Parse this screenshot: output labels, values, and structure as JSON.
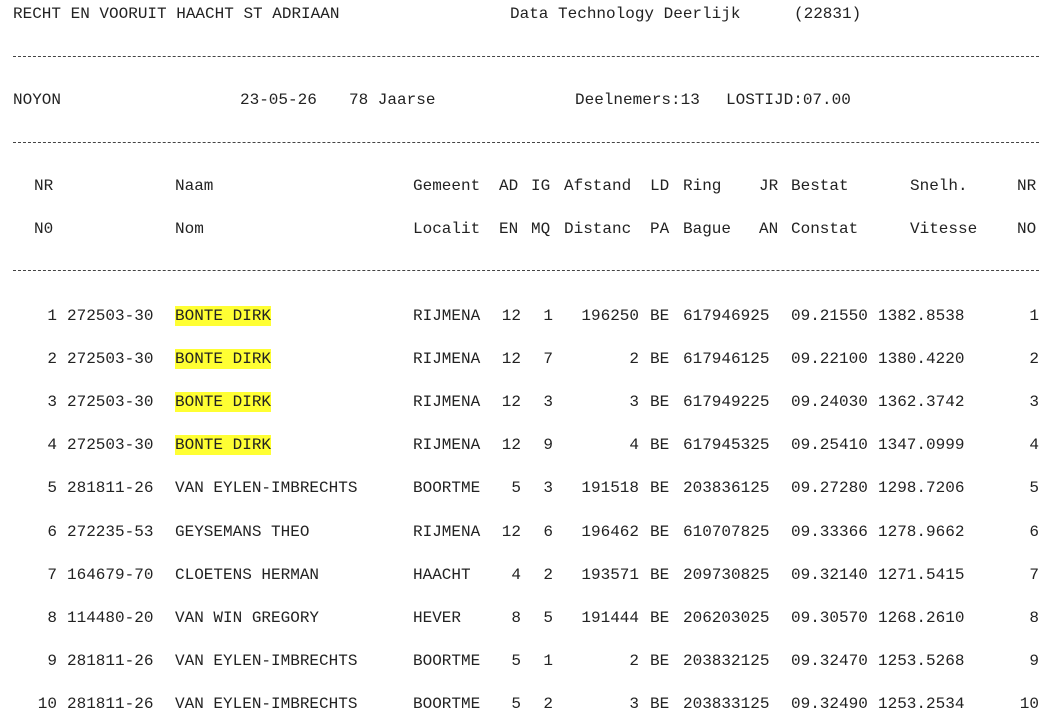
{
  "header": {
    "club": "RECHT EN VOORUIT HAACHT ST ADRIAAN",
    "vendor": "Data Technology Deerlijk",
    "code": "(22831)"
  },
  "race": {
    "place": "NOYON",
    "date": "23-05-26",
    "category": "78 Jaarse",
    "participants": "Deelnemers:13",
    "release": "LOSTIJD:07.00"
  },
  "columns": {
    "line1": [
      "NR",
      "Naam",
      "Gemeent",
      "AD",
      "IG",
      "Afstand",
      "LD",
      "Ring",
      "JR",
      "Bestat",
      "Snelh.",
      "NR"
    ],
    "line2": [
      "N0",
      "Nom",
      "Localit",
      "EN",
      "MQ",
      "Distanc",
      "PA",
      "Bague",
      "AN",
      "Constat",
      "Vitesse",
      "NO"
    ]
  },
  "highlight_color": "#ffff33",
  "rows": [
    {
      "nr": "1",
      "lid": "272503-30",
      "name": "BONTE DIRK",
      "highlight": true,
      "town": "RIJMENA",
      "ad": "12",
      "ig": "1",
      "dist": "196250",
      "ld": "BE",
      "ring": "617946925",
      "bestat": "09.21550",
      "speed": "1382.8538",
      "nr2": "1"
    },
    {
      "nr": "2",
      "lid": "272503-30",
      "name": "BONTE DIRK",
      "highlight": true,
      "town": "RIJMENA",
      "ad": "12",
      "ig": "7",
      "dist": "2",
      "ld": "BE",
      "ring": "617946125",
      "bestat": "09.22100",
      "speed": "1380.4220",
      "nr2": "2"
    },
    {
      "nr": "3",
      "lid": "272503-30",
      "name": "BONTE DIRK",
      "highlight": true,
      "town": "RIJMENA",
      "ad": "12",
      "ig": "3",
      "dist": "3",
      "ld": "BE",
      "ring": "617949225",
      "bestat": "09.24030",
      "speed": "1362.3742",
      "nr2": "3"
    },
    {
      "nr": "4",
      "lid": "272503-30",
      "name": "BONTE DIRK",
      "highlight": true,
      "town": "RIJMENA",
      "ad": "12",
      "ig": "9",
      "dist": "4",
      "ld": "BE",
      "ring": "617945325",
      "bestat": "09.25410",
      "speed": "1347.0999",
      "nr2": "4"
    },
    {
      "nr": "5",
      "lid": "281811-26",
      "name": "VAN EYLEN-IMBRECHTS",
      "highlight": false,
      "town": "BOORTME",
      "ad": "5",
      "ig": "3",
      "dist": "191518",
      "ld": "BE",
      "ring": "203836125",
      "bestat": "09.27280",
      "speed": "1298.7206",
      "nr2": "5"
    },
    {
      "nr": "6",
      "lid": "272235-53",
      "name": "GEYSEMANS THEO",
      "highlight": false,
      "town": "RIJMENA",
      "ad": "12",
      "ig": "6",
      "dist": "196462",
      "ld": "BE",
      "ring": "610707825",
      "bestat": "09.33366",
      "speed": "1278.9662",
      "nr2": "6"
    },
    {
      "nr": "7",
      "lid": "164679-70",
      "name": "CLOETENS HERMAN",
      "highlight": false,
      "town": "HAACHT",
      "ad": "4",
      "ig": "2",
      "dist": "193571",
      "ld": "BE",
      "ring": "209730825",
      "bestat": "09.32140",
      "speed": "1271.5415",
      "nr2": "7"
    },
    {
      "nr": "8",
      "lid": "114480-20",
      "name": "VAN WIN GREGORY",
      "highlight": false,
      "town": "HEVER",
      "ad": "8",
      "ig": "5",
      "dist": "191444",
      "ld": "BE",
      "ring": "206203025",
      "bestat": "09.30570",
      "speed": "1268.2610",
      "nr2": "8"
    },
    {
      "nr": "9",
      "lid": "281811-26",
      "name": "VAN EYLEN-IMBRECHTS",
      "highlight": false,
      "town": "BOORTME",
      "ad": "5",
      "ig": "1",
      "dist": "2",
      "ld": "BE",
      "ring": "203832125",
      "bestat": "09.32470",
      "speed": "1253.5268",
      "nr2": "9"
    },
    {
      "nr": "10",
      "lid": "281811-26",
      "name": "VAN EYLEN-IMBRECHTS",
      "highlight": false,
      "town": "BOORTME",
      "ad": "5",
      "ig": "2",
      "dist": "3",
      "ld": "BE",
      "ring": "203833125",
      "bestat": "09.32490",
      "speed": "1253.2534",
      "nr2": "10"
    }
  ]
}
